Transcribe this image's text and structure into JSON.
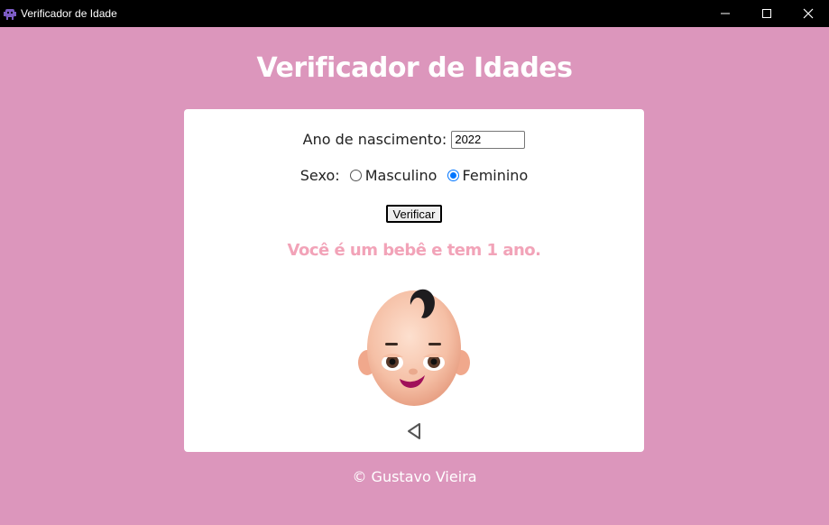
{
  "window": {
    "title": "Verificador de Idade",
    "app_icon": "alien-monster-icon",
    "controls": [
      "minimize-icon",
      "maximize-icon",
      "close-icon"
    ]
  },
  "page": {
    "heading": "Verificador de Idades",
    "footer": "© Gustavo Vieira"
  },
  "form": {
    "year_label": "Ano de nascimento:",
    "year_value": "2022",
    "sex_label": "Sexo:",
    "options": [
      {
        "label": "Masculino",
        "checked": false
      },
      {
        "label": "Feminino",
        "checked": true
      }
    ],
    "button_label": "Verificar"
  },
  "result": {
    "text": "Você é um bebê e tem 1 ano.",
    "image": "baby-face-icon",
    "nav_icon": "triangle-left-icon"
  },
  "colors": {
    "background": "#dc96bc",
    "result_text": "#f2a3b8",
    "radio_accent": "#0075ff"
  }
}
